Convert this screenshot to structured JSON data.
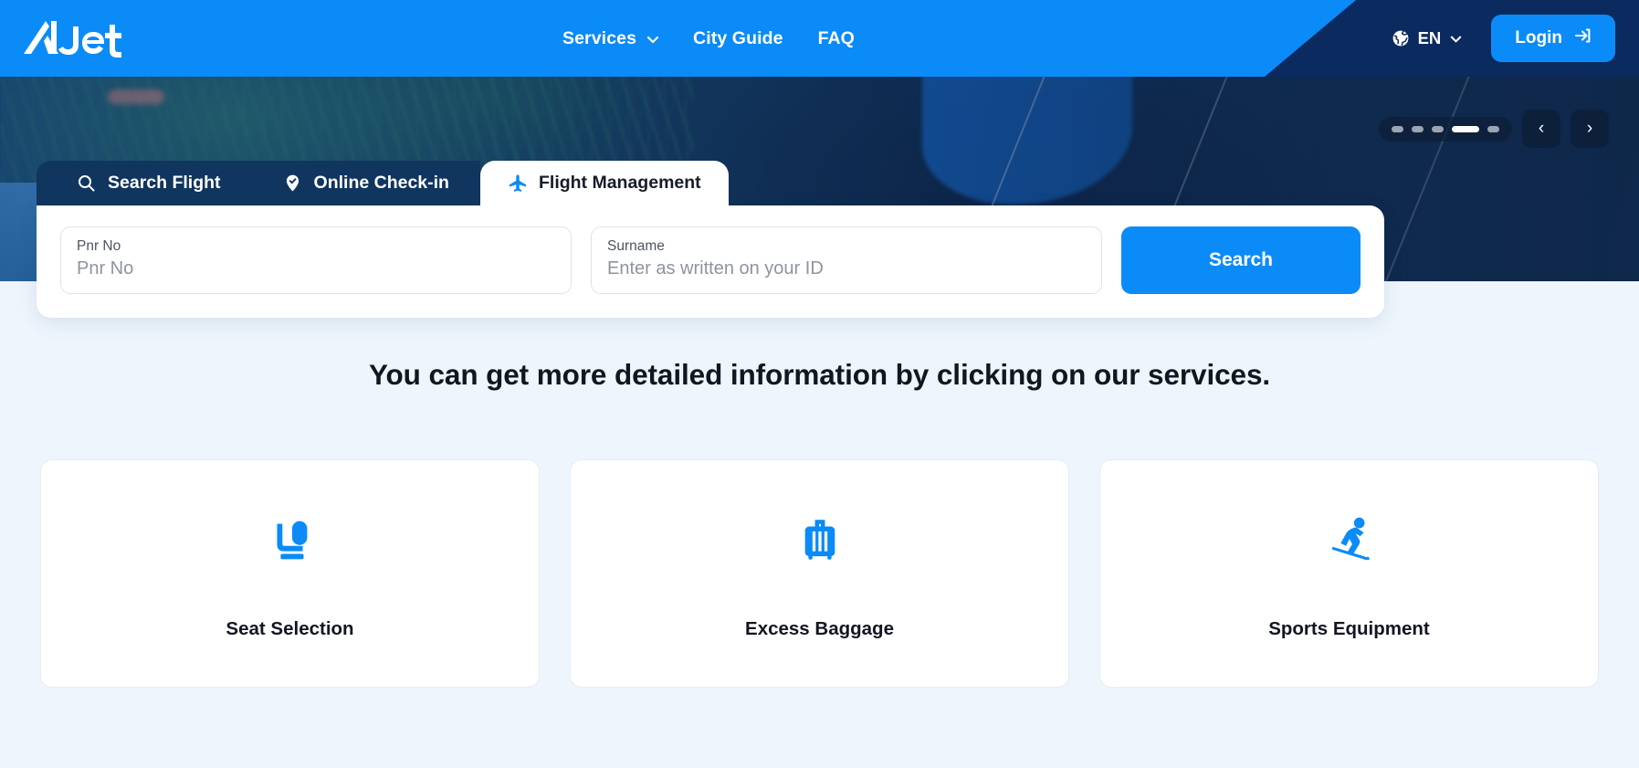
{
  "brand": {
    "name": "AJet",
    "primary_color": "#0b8bf7",
    "dark_color": "#0a2a60"
  },
  "header": {
    "logo_text": "AJet",
    "nav": [
      {
        "label": "Services",
        "has_dropdown": true,
        "icon": "chevron-down-icon"
      },
      {
        "label": "City Guide",
        "has_dropdown": false,
        "icon": ""
      },
      {
        "label": "FAQ",
        "has_dropdown": false,
        "icon": ""
      }
    ],
    "language": {
      "icon": "globe-icon",
      "value": "EN",
      "chevron": "chevron-down-icon"
    },
    "login": {
      "label": "Login",
      "icon": "login-arrow-icon"
    }
  },
  "hero": {
    "carousel": {
      "dot_count": 5,
      "active_index": 3,
      "prev_label": "‹",
      "next_label": "›"
    }
  },
  "widget": {
    "tabs": [
      {
        "label": "Search Flight",
        "icon": "search-icon",
        "active": false
      },
      {
        "label": "Online Check-in",
        "icon": "check-pin-icon",
        "active": false
      },
      {
        "label": "Flight Management",
        "icon": "airplane-icon",
        "active": true
      }
    ],
    "fields": [
      {
        "label": "Pnr No",
        "value": "",
        "placeholder": "Pnr No"
      },
      {
        "label": "Surname",
        "value": "",
        "placeholder": "Enter as written on your ID"
      }
    ],
    "search_button": "Search"
  },
  "services": {
    "title": "You can get more detailed information by clicking on our services.",
    "cards": [
      {
        "label": "Seat Selection",
        "icon": "seat-icon"
      },
      {
        "label": "Excess Baggage",
        "icon": "suitcase-icon"
      },
      {
        "label": "Sports Equipment",
        "icon": "skier-icon"
      }
    ]
  }
}
